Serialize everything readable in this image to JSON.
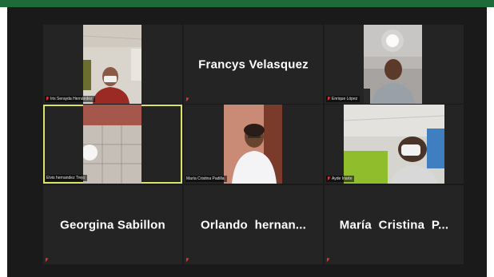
{
  "colors": {
    "accent_border": "#d9e36b",
    "muted_mic": "#e0342f",
    "window_bg": "#1a1a1a",
    "tile_bg": "#242424"
  },
  "participants": [
    {
      "name": "Iris Serayda Hernández",
      "type": "video",
      "muted": true
    },
    {
      "name": "Francys Velasquez",
      "type": "name",
      "muted": true
    },
    {
      "name": "Enrique López",
      "type": "video",
      "muted": true
    },
    {
      "name": "Elvis hernandez Trejo",
      "type": "video",
      "muted": false,
      "active_speaker": true
    },
    {
      "name": "María Cristina Padilla",
      "type": "video",
      "muted": true
    },
    {
      "name": "Ayde Iriarte",
      "type": "video",
      "muted": true
    },
    {
      "name": "Georgina Sabillon",
      "type": "name",
      "muted": true
    },
    {
      "name": "Orlando  hernan...",
      "type": "name",
      "muted": true
    },
    {
      "name": "María  Cristina  P...",
      "type": "name",
      "muted": true
    }
  ]
}
